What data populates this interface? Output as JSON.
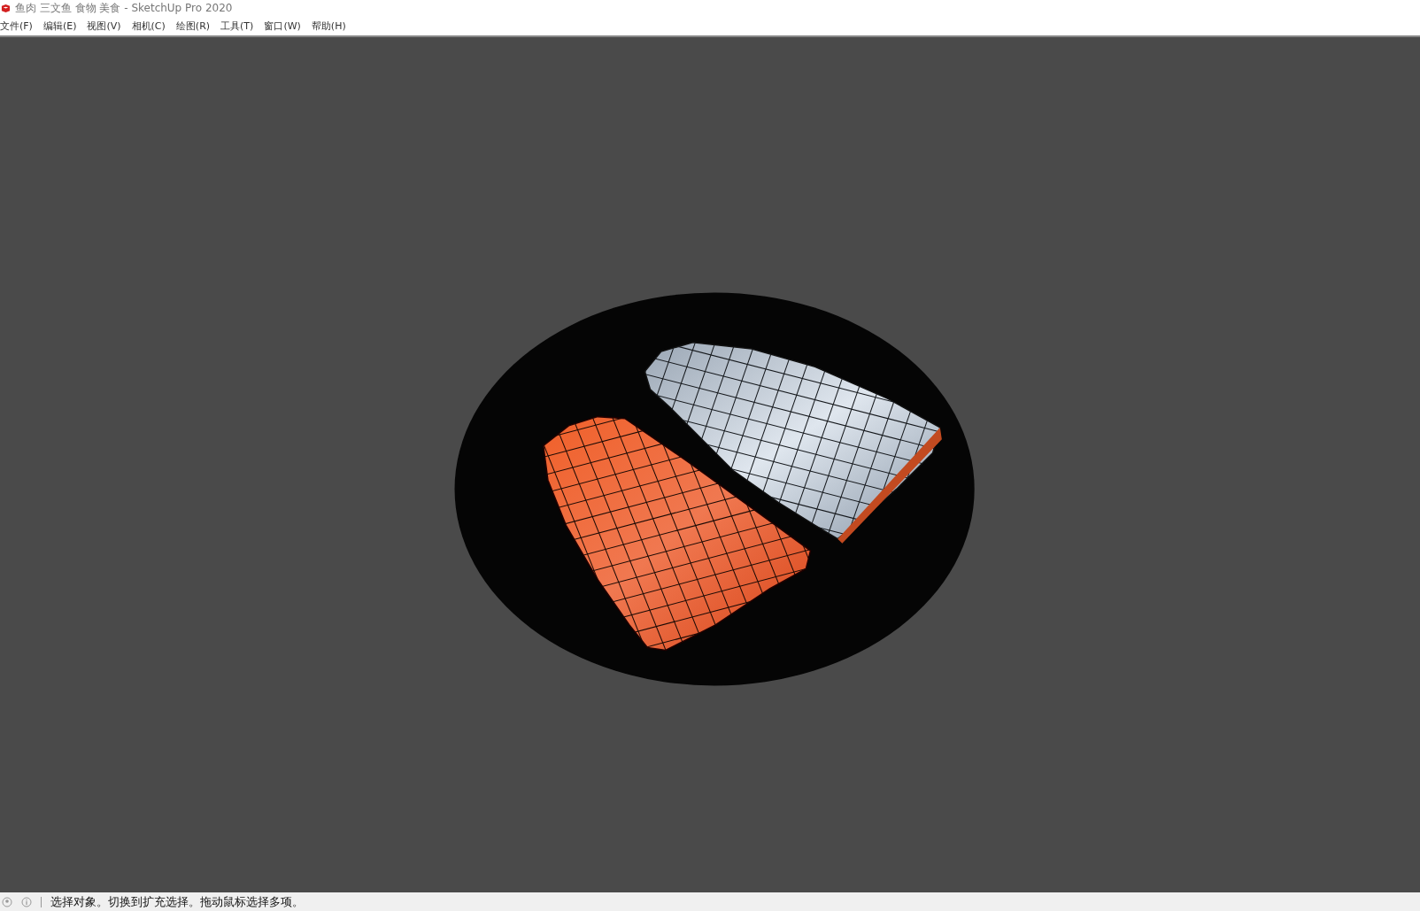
{
  "window": {
    "title": "鱼肉 三文鱼 食物 美食 - SketchUp Pro 2020"
  },
  "menu": [
    "文件(F)",
    "编辑(E)",
    "视图(V)",
    "相机(C)",
    "绘图(R)",
    "工具(T)",
    "窗口(W)",
    "帮助(H)"
  ],
  "status_bar": {
    "message": "选择对象。切换到扩充选择。拖动鼠标选择多项。"
  }
}
